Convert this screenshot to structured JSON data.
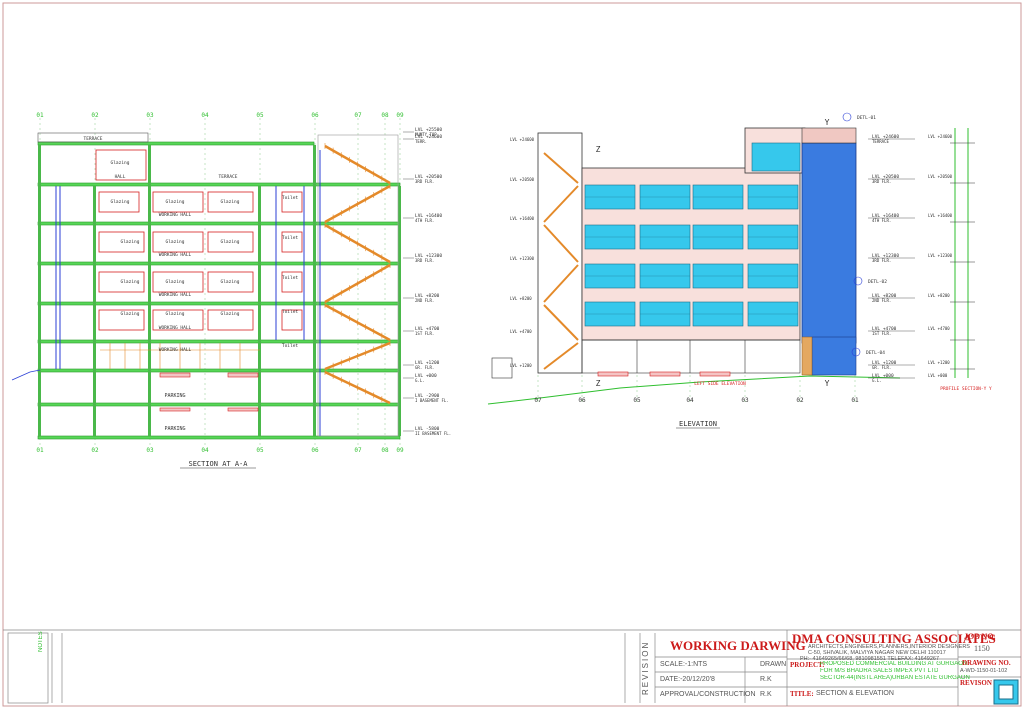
{
  "drawing": {
    "grid_labels_section": [
      "01",
      "02",
      "03",
      "04",
      "05",
      "06",
      "07",
      "08",
      "09"
    ],
    "grid_labels_elevation": [
      "07",
      "06",
      "05",
      "04",
      "03",
      "02",
      "01"
    ],
    "section_title": "SECTION AT A-A",
    "elevation_title": "ELEVATION",
    "left_side_elevation": "LEFT SIDE ELEVATION",
    "profile_section": "PROFILE SECTION-Y Y",
    "dtl_labels": [
      "DETL-01",
      "DETL-02",
      "DETL-04"
    ],
    "markers": [
      "Z",
      "Y",
      "Z",
      "Y"
    ],
    "room_labels": {
      "terrace": "TERRACE",
      "hall": "HALL",
      "working_hall": "WORKING HALL",
      "parking": "PARKING",
      "glazing": "Glazing",
      "toilet": "Toilet"
    },
    "levels_section": [
      {
        "lvl": "LVL +25500",
        "desc": "MUMTY TOP"
      },
      {
        "lvl": "LVL +24600",
        "desc": "TERR."
      },
      {
        "lvl": "LVL +20500",
        "desc": "3RD FLR."
      },
      {
        "lvl": "LVL +16400",
        "desc": "4TH FLR."
      },
      {
        "lvl": "LVL +12300",
        "desc": "3RD FLR."
      },
      {
        "lvl": "LVL +8200",
        "desc": "2ND FLR."
      },
      {
        "lvl": "LVL +4700",
        "desc": "1ST FLR."
      },
      {
        "lvl": "LVL +1200",
        "desc": "GR. FLR."
      },
      {
        "lvl": "LVL +000",
        "desc": "G.L."
      },
      {
        "lvl": "LVL -2900",
        "desc": "I BASEMENT FL."
      },
      {
        "lvl": "LVL -5800",
        "desc": "II BASEMENT FL."
      }
    ],
    "levels_elevation": [
      {
        "lvl": "LVL +24600",
        "desc": "TERRACE"
      },
      {
        "lvl": "LVL +20500",
        "desc": "3RD FLR."
      },
      {
        "lvl": "LVL +16400",
        "desc": "4TH FLR."
      },
      {
        "lvl": "LVL +12300",
        "desc": "3RD FLR."
      },
      {
        "lvl": "LVL +8200",
        "desc": "2ND FLR."
      },
      {
        "lvl": "LVL +4700",
        "desc": "1ST FLR."
      },
      {
        "lvl": "LVL +1200",
        "desc": "GR. FLR."
      },
      {
        "lvl": "LVL +000",
        "desc": "G.L."
      }
    ]
  },
  "titleblock": {
    "stage": "WORKING DARWING",
    "revision_label": "REVISION",
    "scale": "SCALE:-1:NTS",
    "date": "DATE:-20/12/20'8",
    "approval": "APPROVAL/CONSTRUCTION",
    "drawn": "DRAWN",
    "checked": "R.K",
    "approved": "R.K",
    "firm_name": "DMA CONSULTING ASSOCIATES",
    "firm_line1": "ARCHITECTS,ENGINEERS,PLANNERS,INTERIOR DESIGNERS",
    "firm_line2": "C-50, SHIVALIK, MALVIYA NAGAR NEW DELHI 110017",
    "firm_line3": "PH:- 41649265/66/68, 9810981551 TELEFAX: 41649267",
    "project_label": "PROJECT:",
    "project_line1": "PROPOSED COMMERCIAL BUILDING AT GURGAON",
    "project_line2": "FOR M/S BHADRA SALES IMPEX PVT LTD",
    "project_line3": "SECTOR-44(INSTL AREA)URBAN ESTATE GURGAON",
    "title_label": "TITLE:",
    "title_value": "SECTION & ELEVATION",
    "job_label": "JOB NO.",
    "job_value": "1150",
    "drawing_label": "DRAWING NO.",
    "drawing_value": "A-WD-1150-01-102",
    "revision_short": "REVISON",
    "notes_stamp": "NOTES"
  },
  "colors": {
    "grid_green": "#2fbf2f",
    "wall_red": "#d62020",
    "stair_orange": "#e48a2a",
    "glass_cyan": "#36c8ec",
    "glass_blue": "#3a7be0",
    "blue_line": "#2b3fd6",
    "firm_red": "#cc1a1a"
  }
}
